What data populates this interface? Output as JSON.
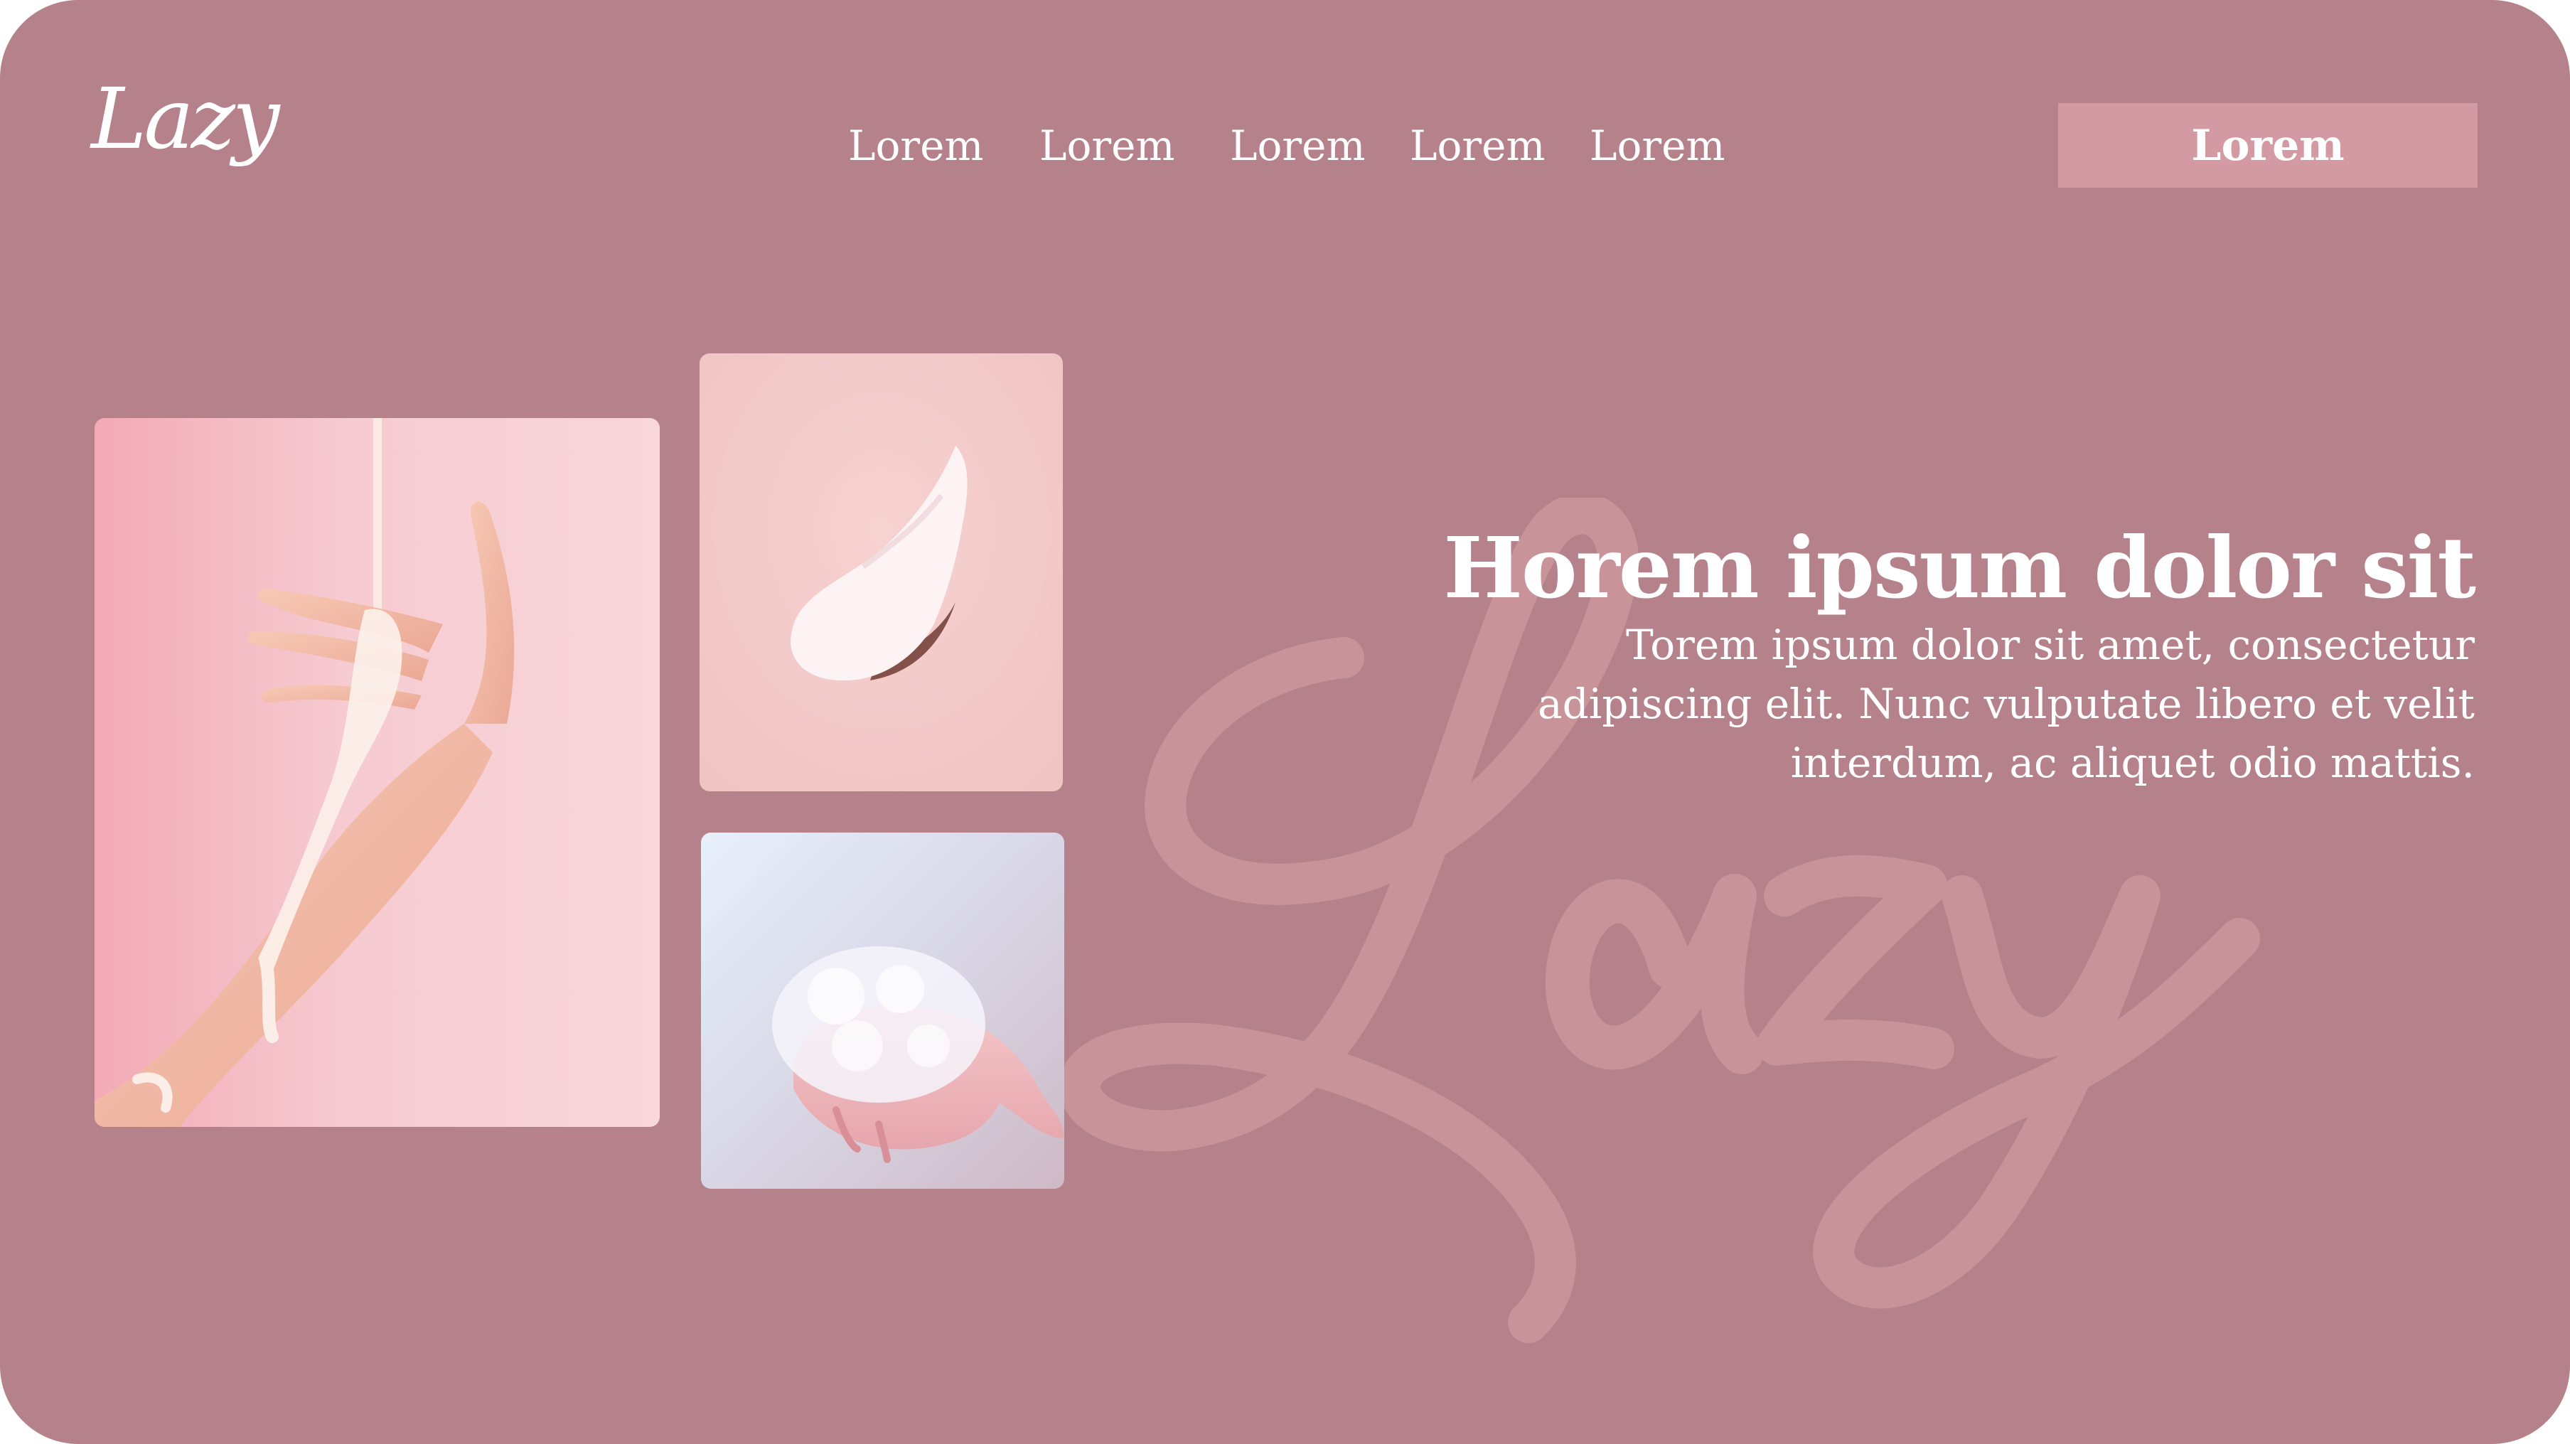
{
  "header": {
    "logo": "Lazy",
    "nav": [
      "Lorem",
      "Lorem",
      "Lorem",
      "Lorem",
      "Lorem"
    ],
    "cta_label": "Lorem"
  },
  "hero": {
    "title": "Horem ipsum dolor sit",
    "body": "Torem ipsum dolor sit amet, consectetur adipiscing elit. Nunc vulputate libero et velit interdum, ac aliquet odio mattis.",
    "watermark": "Lazy"
  },
  "colors": {
    "background": "#b5818b",
    "accent_button": "#d49aa4",
    "watermark": "#c9939a",
    "text": "#ffffff"
  },
  "images": [
    {
      "name": "hand-with-cream",
      "alt": "hand covered in pouring cream"
    },
    {
      "name": "cream-swatch",
      "alt": "swatch of white cream"
    },
    {
      "name": "hand-with-foam",
      "alt": "open hand holding foam"
    }
  ]
}
